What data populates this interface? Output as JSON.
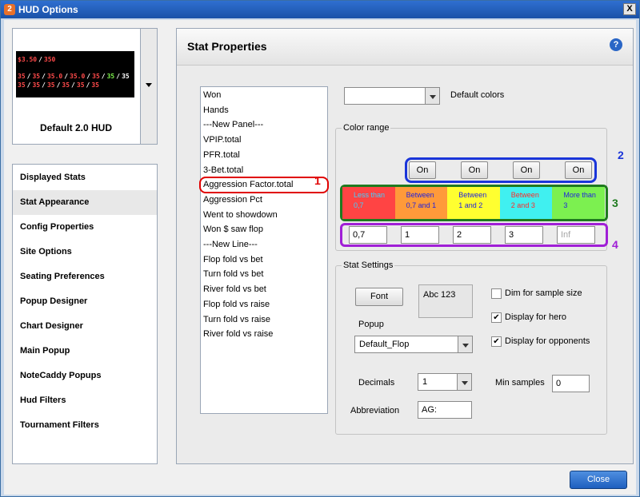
{
  "window": {
    "title": "HUD Options",
    "icon_glyph": "2",
    "close_glyph": "X"
  },
  "preview": {
    "label": "Default 2.0 HUD",
    "line1": [
      {
        "t": "$3.50",
        "c": "#ff4a4a"
      },
      {
        "t": "/",
        "c": "#ffffff"
      },
      {
        "t": "350",
        "c": "#ff4a4a"
      }
    ],
    "line2": [
      {
        "t": "35",
        "c": "#ff4a4a"
      },
      {
        "t": "/",
        "c": "#ffffff"
      },
      {
        "t": "35",
        "c": "#ff4a4a"
      },
      {
        "t": "/",
        "c": "#ffffff"
      },
      {
        "t": "35.0",
        "c": "#ff4a4a"
      },
      {
        "t": "/",
        "c": "#ffffff"
      },
      {
        "t": "35.0",
        "c": "#ff4a4a"
      },
      {
        "t": "/",
        "c": "#ffffff"
      },
      {
        "t": "35",
        "c": "#ff4a4a"
      },
      {
        "t": "/",
        "c": "#ffffff"
      },
      {
        "t": "35",
        "c": "#7cf04a"
      },
      {
        "t": "/",
        "c": "#ffffff"
      },
      {
        "t": "35",
        "c": "#ffffff"
      }
    ],
    "line3": [
      {
        "t": "35",
        "c": "#ff4a4a"
      },
      {
        "t": "/",
        "c": "#ffffff"
      },
      {
        "t": "35",
        "c": "#ff4a4a"
      },
      {
        "t": "/",
        "c": "#ffffff"
      },
      {
        "t": "35",
        "c": "#ff4a4a"
      },
      {
        "t": "/",
        "c": "#ffffff"
      },
      {
        "t": "35",
        "c": "#ff4a4a"
      },
      {
        "t": "/",
        "c": "#ffffff"
      },
      {
        "t": "35",
        "c": "#ff4a4a"
      },
      {
        "t": "/",
        "c": "#ffffff"
      },
      {
        "t": "35",
        "c": "#ff4a4a"
      }
    ]
  },
  "nav": {
    "items": [
      "Displayed Stats",
      "Stat Appearance",
      "Config Properties",
      "Site Options",
      "Seating Preferences",
      "Popup Designer",
      "Chart Designer",
      "Main Popup",
      "NoteCaddy Popups",
      "Hud Filters",
      "Tournament Filters"
    ],
    "active_index": 1
  },
  "main": {
    "title": "Stat Properties",
    "help_glyph": "?"
  },
  "stats": {
    "items": [
      "Won",
      "Hands",
      "---New Panel---",
      "VPIP.total",
      "PFR.total",
      "3-Bet.total",
      "Aggression Factor.total",
      "Aggression Pct",
      "Went to showdown",
      "Won $ saw flop",
      "---New Line---",
      "Flop fold vs bet",
      "Turn fold vs bet",
      "River fold vs bet",
      "Flop fold vs raise",
      "Turn fold vs raise",
      "River fold vs raise"
    ],
    "selected_index": 6
  },
  "default_colors": {
    "value": "",
    "label": "Default colors"
  },
  "color_range": {
    "title": "Color range",
    "on_buttons": [
      "On",
      "On",
      "On",
      "On"
    ],
    "cells": [
      {
        "l1": "Less than",
        "l2": "0,7",
        "bg": "#ff4444",
        "fg": "#3fd0ff"
      },
      {
        "l1": "Between",
        "l2": "0,7 and 1",
        "bg": "#ff9a3a",
        "fg": "#2222dd"
      },
      {
        "l1": "Between",
        "l2": "1 and 2",
        "bg": "#ffff30",
        "fg": "#2222dd"
      },
      {
        "l1": "Between",
        "l2": "2 and 3",
        "bg": "#40f0f0",
        "fg": "#ff2a2a"
      },
      {
        "l1": "More than",
        "l2": "3",
        "bg": "#7cf050",
        "fg": "#2222dd"
      }
    ],
    "thresholds": [
      "0,7",
      "1",
      "2",
      "3"
    ],
    "inf_placeholder": "Inf"
  },
  "annotations": [
    "1",
    "2",
    "3",
    "4"
  ],
  "stat_settings": {
    "title": "Stat Settings",
    "font_button": "Font",
    "font_sample": "Abc 123",
    "popup_label": "Popup",
    "popup_value": "Default_Flop",
    "decimals_label": "Decimals",
    "decimals_value": "1",
    "abbrev_label": "Abbreviation",
    "abbrev_value": "AG:",
    "min_samples_label": "Min samples",
    "min_samples_value": "0",
    "checks": [
      {
        "label": "Dim for sample size",
        "checked": false
      },
      {
        "label": "Display for hero",
        "checked": true
      },
      {
        "label": "Display for opponents",
        "checked": true
      }
    ],
    "check_glyph": "✔"
  },
  "footer": {
    "close_label": "Close"
  }
}
